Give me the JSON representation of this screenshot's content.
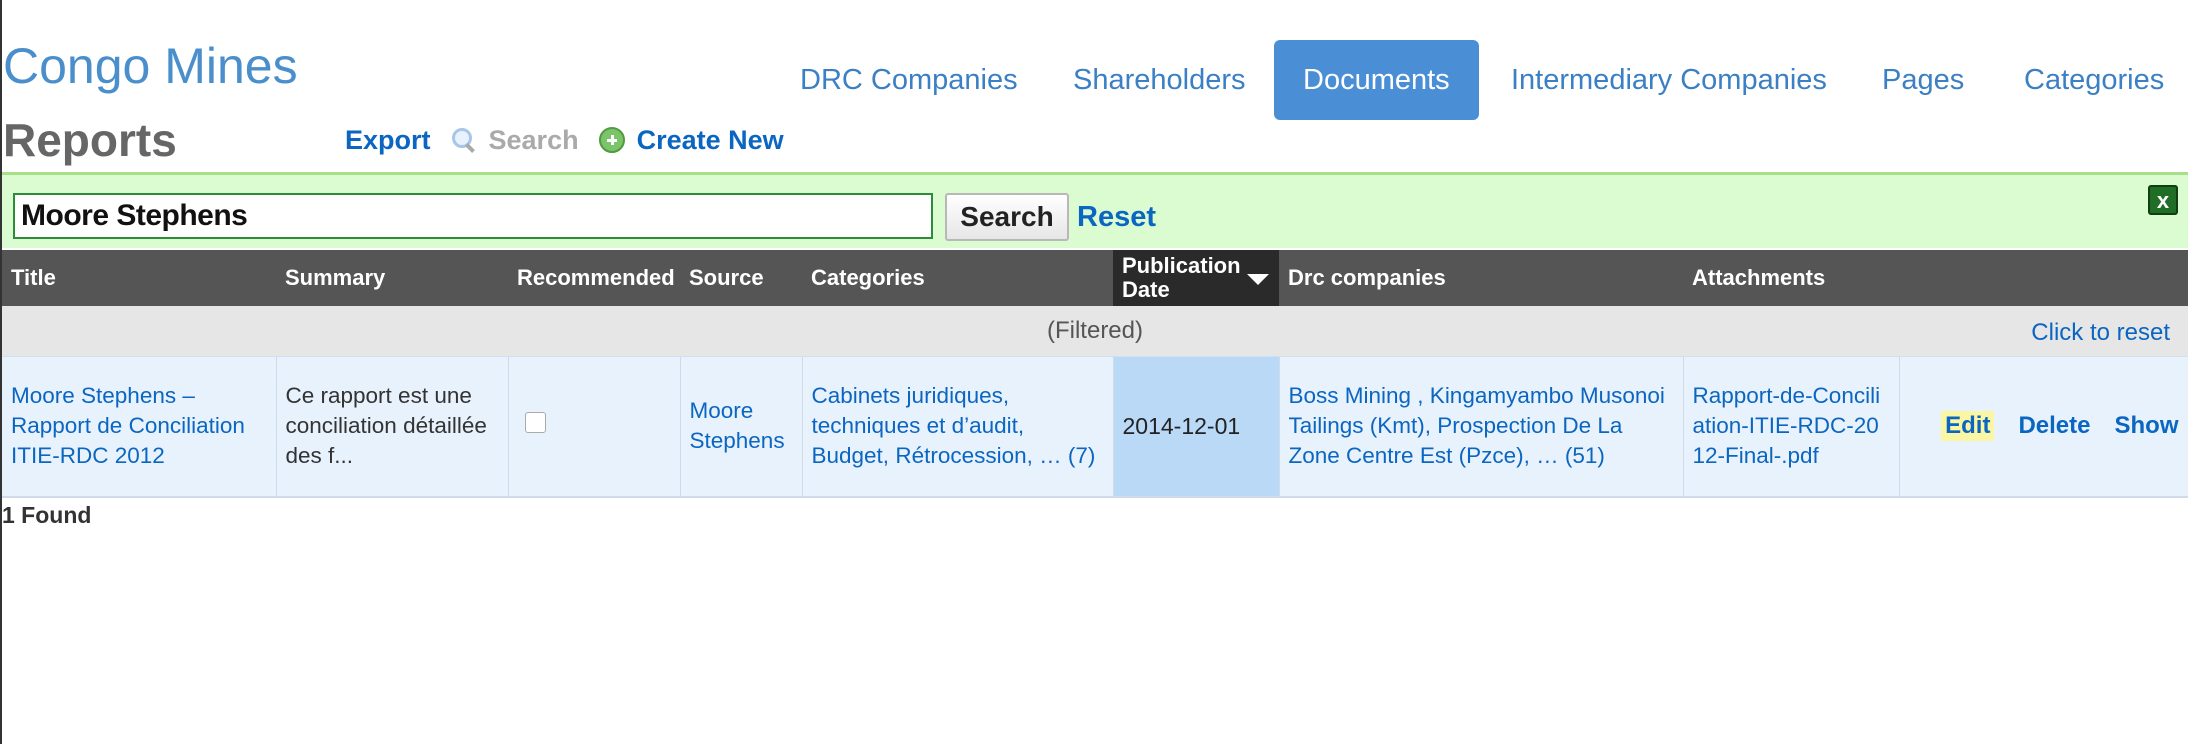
{
  "app": {
    "brand": "Congo Mines"
  },
  "nav": {
    "items": [
      {
        "label": "DRC Companies",
        "active": false
      },
      {
        "label": "Shareholders",
        "active": false
      },
      {
        "label": "Documents",
        "active": true
      },
      {
        "label": "Intermediary Companies",
        "active": false
      },
      {
        "label": "Pages",
        "active": false
      },
      {
        "label": "Categories",
        "active": false
      }
    ]
  },
  "page": {
    "title": "Reports"
  },
  "actions": {
    "export": "Export",
    "search": "Search",
    "create_new": "Create New",
    "search_icon": "magnifier-icon",
    "create_icon": "plus-circle-icon"
  },
  "search": {
    "value": "Moore Stephens",
    "button": "Search",
    "reset": "Reset",
    "close": "x"
  },
  "table": {
    "columns": [
      "Title",
      "Summary",
      "Recommended",
      "Source",
      "Categories",
      "Publication Date",
      "Drc companies",
      "Attachments",
      ""
    ],
    "sorted_column": "Publication Date",
    "filter_status": "(Filtered)",
    "click_to_reset": "Click to reset",
    "rows": [
      {
        "title": "Moore Stephens – Rapport de Conciliation ITIE-RDC 2012",
        "summary": "Ce rapport est une conciliation détaillée des f...",
        "recommended": false,
        "source": "Moore Stephens",
        "categories": "Cabinets juridiques, techniques et d’audit, Budget, Rétrocession, … (7)",
        "publication_date": "2014-12-01",
        "drc_companies": "Boss Mining , Kingamyambo Musonoi Tailings (Kmt), Prospection De La Zone Centre Est (Pzce), … (51)",
        "attachments": "Rapport-de-Conciliation-ITIE-RDC-2012-Final-.pdf",
        "actions": {
          "edit": "Edit",
          "delete": "Delete",
          "show": "Show"
        }
      }
    ]
  },
  "footer": {
    "count": "1 Found"
  },
  "colors": {
    "brand": "#4a8fcc",
    "active_tab": "#4a8fd6",
    "link": "#0b66c2",
    "search_bar": "#dbfbd0",
    "header": "#555555"
  }
}
